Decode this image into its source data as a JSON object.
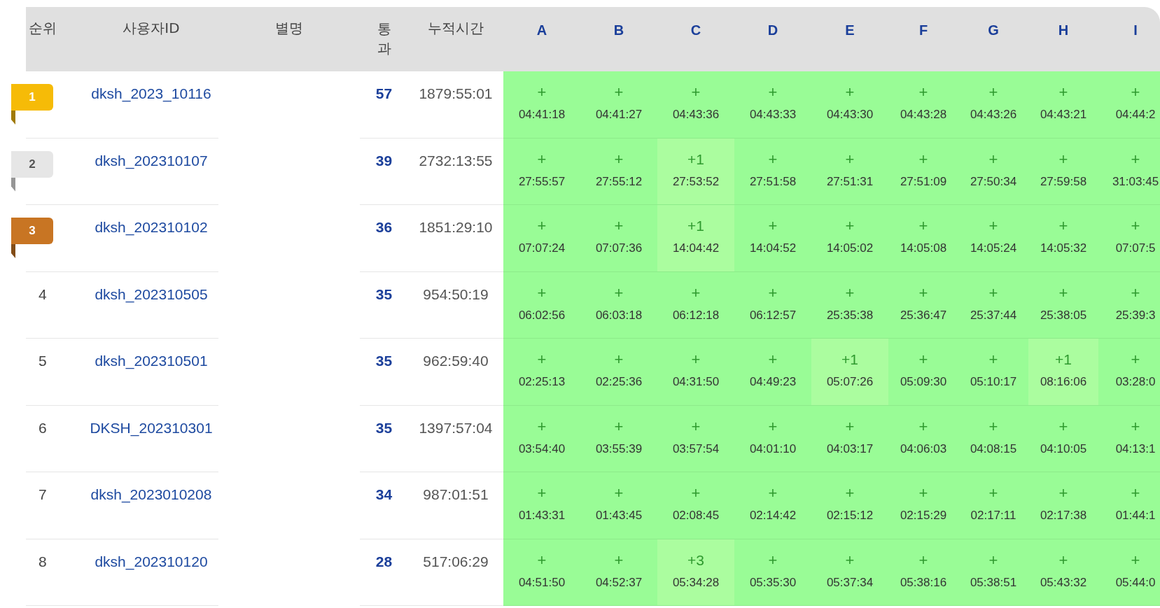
{
  "columns": [
    "순위",
    "사용자ID",
    "별명",
    "통과",
    "누적시간"
  ],
  "problems": [
    "A",
    "B",
    "C",
    "D",
    "E",
    "F",
    "G",
    "H",
    "I"
  ],
  "rows": [
    {
      "rank": "1",
      "kind": "medal",
      "color": "#f6bb07",
      "user": "dksh_2023_10116",
      "solved": "57",
      "total": "1879:55:01",
      "cells": [
        {
          "mark": "+",
          "time": "04:41:18",
          "highlight": false
        },
        {
          "mark": "+",
          "time": "04:41:27",
          "highlight": false
        },
        {
          "mark": "+",
          "time": "04:43:36",
          "highlight": false
        },
        {
          "mark": "+",
          "time": "04:43:33",
          "highlight": false
        },
        {
          "mark": "+",
          "time": "04:43:30",
          "highlight": false
        },
        {
          "mark": "+",
          "time": "04:43:28",
          "highlight": false
        },
        {
          "mark": "+",
          "time": "04:43:26",
          "highlight": false
        },
        {
          "mark": "+",
          "time": "04:43:21",
          "highlight": false
        },
        {
          "mark": "+",
          "time": "04:44:2",
          "highlight": false
        }
      ]
    },
    {
      "rank": "2",
      "kind": "medal",
      "color": "#e6e6e6",
      "user": "dksh_202310107",
      "solved": "39",
      "total": "2732:13:55",
      "cells": [
        {
          "mark": "+",
          "time": "27:55:57",
          "highlight": false
        },
        {
          "mark": "+",
          "time": "27:55:12",
          "highlight": false
        },
        {
          "mark": "+1",
          "time": "27:53:52",
          "highlight": true
        },
        {
          "mark": "+",
          "time": "27:51:58",
          "highlight": false
        },
        {
          "mark": "+",
          "time": "27:51:31",
          "highlight": false
        },
        {
          "mark": "+",
          "time": "27:51:09",
          "highlight": false
        },
        {
          "mark": "+",
          "time": "27:50:34",
          "highlight": false
        },
        {
          "mark": "+",
          "time": "27:59:58",
          "highlight": false
        },
        {
          "mark": "+",
          "time": "31:03:45",
          "highlight": false
        }
      ]
    },
    {
      "rank": "3",
      "kind": "medal",
      "color": "#c87523",
      "user": "dksh_202310102",
      "solved": "36",
      "total": "1851:29:10",
      "cells": [
        {
          "mark": "+",
          "time": "07:07:24",
          "highlight": false
        },
        {
          "mark": "+",
          "time": "07:07:36",
          "highlight": false
        },
        {
          "mark": "+1",
          "time": "14:04:42",
          "highlight": true
        },
        {
          "mark": "+",
          "time": "14:04:52",
          "highlight": false
        },
        {
          "mark": "+",
          "time": "14:05:02",
          "highlight": false
        },
        {
          "mark": "+",
          "time": "14:05:08",
          "highlight": false
        },
        {
          "mark": "+",
          "time": "14:05:24",
          "highlight": false
        },
        {
          "mark": "+",
          "time": "14:05:32",
          "highlight": false
        },
        {
          "mark": "+",
          "time": "07:07:5",
          "highlight": false
        }
      ]
    },
    {
      "rank": "4",
      "kind": "plain",
      "user": "dksh_202310505",
      "solved": "35",
      "total": "954:50:19",
      "cells": [
        {
          "mark": "+",
          "time": "06:02:56",
          "highlight": false
        },
        {
          "mark": "+",
          "time": "06:03:18",
          "highlight": false
        },
        {
          "mark": "+",
          "time": "06:12:18",
          "highlight": false
        },
        {
          "mark": "+",
          "time": "06:12:57",
          "highlight": false
        },
        {
          "mark": "+",
          "time": "25:35:38",
          "highlight": false
        },
        {
          "mark": "+",
          "time": "25:36:47",
          "highlight": false
        },
        {
          "mark": "+",
          "time": "25:37:44",
          "highlight": false
        },
        {
          "mark": "+",
          "time": "25:38:05",
          "highlight": false
        },
        {
          "mark": "+",
          "time": "25:39:3",
          "highlight": false
        }
      ]
    },
    {
      "rank": "5",
      "kind": "plain",
      "user": "dksh_202310501",
      "solved": "35",
      "total": "962:59:40",
      "cells": [
        {
          "mark": "+",
          "time": "02:25:13",
          "highlight": false
        },
        {
          "mark": "+",
          "time": "02:25:36",
          "highlight": false
        },
        {
          "mark": "+",
          "time": "04:31:50",
          "highlight": false
        },
        {
          "mark": "+",
          "time": "04:49:23",
          "highlight": false
        },
        {
          "mark": "+1",
          "time": "05:07:26",
          "highlight": true
        },
        {
          "mark": "+",
          "time": "05:09:30",
          "highlight": false
        },
        {
          "mark": "+",
          "time": "05:10:17",
          "highlight": false
        },
        {
          "mark": "+1",
          "time": "08:16:06",
          "highlight": true
        },
        {
          "mark": "+",
          "time": "03:28:0",
          "highlight": false
        }
      ]
    },
    {
      "rank": "6",
      "kind": "plain",
      "user": "DKSH_202310301",
      "solved": "35",
      "total": "1397:57:04",
      "cells": [
        {
          "mark": "+",
          "time": "03:54:40",
          "highlight": false
        },
        {
          "mark": "+",
          "time": "03:55:39",
          "highlight": false
        },
        {
          "mark": "+",
          "time": "03:57:54",
          "highlight": false
        },
        {
          "mark": "+",
          "time": "04:01:10",
          "highlight": false
        },
        {
          "mark": "+",
          "time": "04:03:17",
          "highlight": false
        },
        {
          "mark": "+",
          "time": "04:06:03",
          "highlight": false
        },
        {
          "mark": "+",
          "time": "04:08:15",
          "highlight": false
        },
        {
          "mark": "+",
          "time": "04:10:05",
          "highlight": false
        },
        {
          "mark": "+",
          "time": "04:13:1",
          "highlight": false
        }
      ]
    },
    {
      "rank": "7",
      "kind": "plain",
      "user": "dksh_2023010208",
      "solved": "34",
      "total": "987:01:51",
      "cells": [
        {
          "mark": "+",
          "time": "01:43:31",
          "highlight": false
        },
        {
          "mark": "+",
          "time": "01:43:45",
          "highlight": false
        },
        {
          "mark": "+",
          "time": "02:08:45",
          "highlight": false
        },
        {
          "mark": "+",
          "time": "02:14:42",
          "highlight": false
        },
        {
          "mark": "+",
          "time": "02:15:12",
          "highlight": false
        },
        {
          "mark": "+",
          "time": "02:15:29",
          "highlight": false
        },
        {
          "mark": "+",
          "time": "02:17:11",
          "highlight": false
        },
        {
          "mark": "+",
          "time": "02:17:38",
          "highlight": false
        },
        {
          "mark": "+",
          "time": "01:44:1",
          "highlight": false
        }
      ]
    },
    {
      "rank": "8",
      "kind": "plain",
      "user": "dksh_202310120",
      "solved": "28",
      "total": "517:06:29",
      "cells": [
        {
          "mark": "+",
          "time": "04:51:50",
          "highlight": false
        },
        {
          "mark": "+",
          "time": "04:52:37",
          "highlight": false
        },
        {
          "mark": "+3",
          "time": "05:34:28",
          "highlight": true
        },
        {
          "mark": "+",
          "time": "05:35:30",
          "highlight": false
        },
        {
          "mark": "+",
          "time": "05:37:34",
          "highlight": false
        },
        {
          "mark": "+",
          "time": "05:38:16",
          "highlight": false
        },
        {
          "mark": "+",
          "time": "05:38:51",
          "highlight": false
        },
        {
          "mark": "+",
          "time": "05:43:32",
          "highlight": false
        },
        {
          "mark": "+",
          "time": "05:44:0",
          "highlight": false
        }
      ]
    }
  ]
}
